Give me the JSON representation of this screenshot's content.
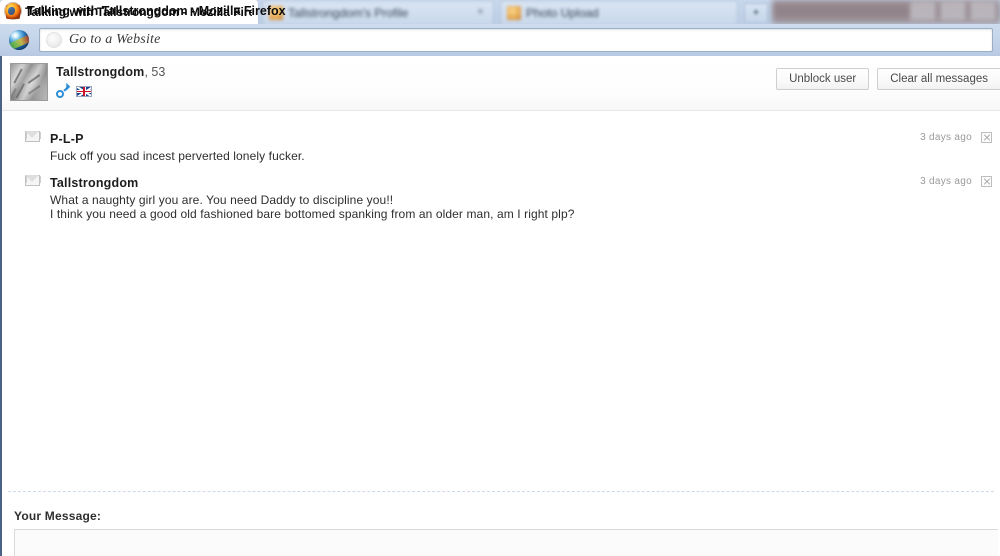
{
  "window": {
    "title": "Talking with Tallstrongdom - Mozilla Firefox",
    "logo_icon": "firefox-icon",
    "controls": [
      "minimize",
      "maximize",
      "close"
    ]
  },
  "tabs": [
    {
      "label": "Talking with Tallstrongdom - Mozilla Firefox",
      "active": true,
      "favicon": "firefox-favicon",
      "close": "×"
    },
    {
      "label": "Tallstrongdom's Profile",
      "active": false,
      "favicon": "site-favicon",
      "close": "×"
    },
    {
      "label": "Photo Upload",
      "active": false,
      "favicon": "site-favicon",
      "close": "×"
    }
  ],
  "new_tab_label": "+",
  "navbar": {
    "brand_icon": "globe-icon",
    "address": {
      "value": "",
      "placeholder": "Go to a Website",
      "favicon": "blank-favicon"
    }
  },
  "profile": {
    "avatar_icon": "user-avatar",
    "username": "Tallstrongdom",
    "age": ", 53",
    "gender_icon": "male-gender-icon",
    "country_icon": "uk-flag-icon",
    "actions": [
      {
        "label": "Unblock user",
        "name": "unblock-user-button"
      },
      {
        "label": "Clear all messages",
        "name": "clear-all-messages-button"
      }
    ]
  },
  "messages": [
    {
      "icon": "open-mail-icon",
      "sender": "P-L-P",
      "lines": [
        "Fuck off you sad incest perverted lonely fucker."
      ],
      "time": "3 days ago",
      "delete_icon": "delete-message-icon"
    },
    {
      "icon": "open-mail-icon",
      "sender": "Tallstrongdom",
      "lines": [
        "What a naughty girl you are. You need Daddy to discipline you!!",
        "I think you need a good old fashioned bare bottomed spanking from an older man, am I right plp?"
      ],
      "time": "3 days ago",
      "delete_icon": "delete-message-icon"
    }
  ],
  "compose": {
    "label": "Your Message:",
    "value": "",
    "placeholder": ""
  },
  "colors": {
    "chrome": "#c3d3e9",
    "accent_blue": "#2c8fd6",
    "flag_red": "#cf1225",
    "flag_blue": "#17438c",
    "text": "#2e2e2e",
    "muted": "#9a9a9a"
  }
}
